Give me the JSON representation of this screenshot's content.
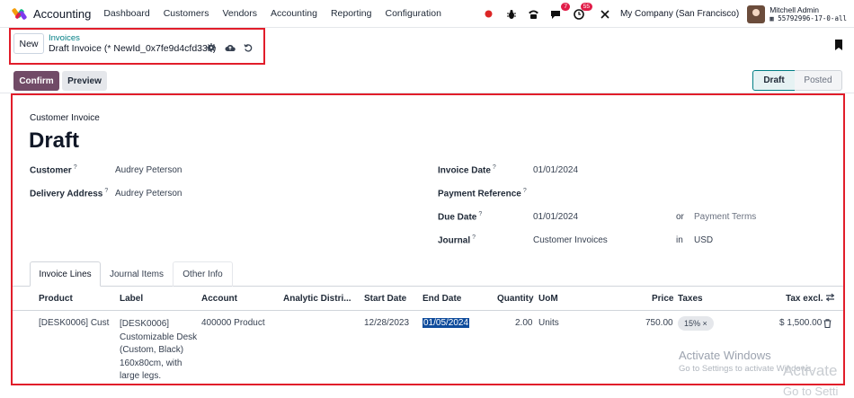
{
  "navbar": {
    "app_title": "Accounting",
    "menu": [
      "Dashboard",
      "Customers",
      "Vendors",
      "Accounting",
      "Reporting",
      "Configuration"
    ],
    "chat_badge": "7",
    "activity_badge": "55",
    "company": "My Company (San Francisco)",
    "user_name": "Mitchell Admin",
    "database": "55792996-17-0-all",
    "brand_colors": [
      "#f59e0b",
      "#10b981",
      "#7c3aed",
      "#e11d48"
    ],
    "icons": [
      "status-dot-icon",
      "bug-icon",
      "phone-icon",
      "chat-icon",
      "clock-icon",
      "tools-icon"
    ]
  },
  "control_panel": {
    "new_label": "New",
    "breadcrumb": "Invoices",
    "record_title": "Draft Invoice (* NewId_0x7fe9d4cfd330)"
  },
  "status_bar": {
    "confirm_label": "Confirm",
    "preview_label": "Preview",
    "stages": [
      "Draft",
      "Posted"
    ],
    "active_stage": "Draft"
  },
  "form": {
    "move_type": "Customer Invoice",
    "name": "Draft",
    "left_fields": [
      {
        "label": "Customer",
        "help": "?",
        "value": "Audrey Peterson"
      },
      {
        "label": "Delivery Address",
        "help": "?",
        "value": "Audrey Peterson"
      }
    ],
    "right_fields": [
      {
        "label": "Invoice Date",
        "help": "?",
        "value": "01/01/2024"
      },
      {
        "label": "Payment Reference",
        "help": "?",
        "value": ""
      },
      {
        "label": "Due Date",
        "help": "?",
        "value": "01/01/2024",
        "or": "or",
        "extra": "Payment Terms"
      },
      {
        "label": "Journal",
        "help": "?",
        "value": "Customer Invoices",
        "or": "in",
        "extra": "USD"
      }
    ]
  },
  "tabs": [
    "Invoice Lines",
    "Journal Items",
    "Other Info"
  ],
  "table": {
    "headers": [
      "Product",
      "Label",
      "Account",
      "Analytic Distri...",
      "Start Date",
      "End Date",
      "Quantity",
      "UoM",
      "Price",
      "Taxes",
      "Tax excl."
    ],
    "row": {
      "product": "[DESK0006] Cust",
      "label": "[DESK0006] Customizable Desk (Custom, Black) 160x80cm, with large legs.",
      "account": "400000 Product S",
      "start_date": "12/28/2023",
      "end_date": "01/05/2024",
      "quantity": "2.00",
      "uom": "Units",
      "price": "750.00",
      "tax": "15% ×",
      "subtotal": "$ 1,500.00"
    }
  },
  "watermark": {
    "line1": "Activate Windows",
    "line2": "Go to Settings to activate Windows.",
    "line3": "Activate",
    "line4": "Go to Setti"
  }
}
